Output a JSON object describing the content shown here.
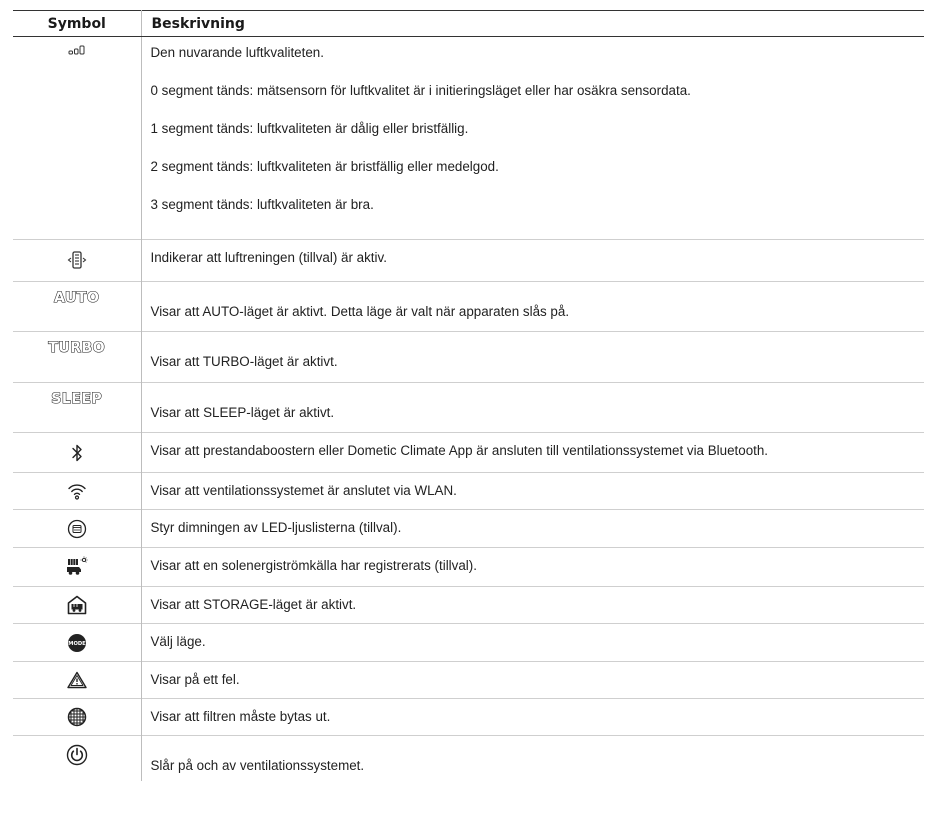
{
  "table": {
    "headers": {
      "symbol": "Symbol",
      "description": "Beskrivning"
    },
    "rows": {
      "air_quality": {
        "icon": "signal-bars-icon",
        "lines": [
          "Den nuvarande luftkvaliteten.",
          "0 segment tänds: mätsensorn för luftkvalitet är i initieringsläget eller har osäkra sensordata.",
          "1 segment tänds: luftkvaliteten är dålig eller bristfällig.",
          "2 segment tänds: luftkvaliteten är bristfällig eller medelgod.",
          "3 segment tänds: luftkvaliteten är bra."
        ]
      },
      "air_purification": {
        "icon": "air-purifier-icon",
        "text": "Indikerar att luftreningen (tillval) är aktiv."
      },
      "auto": {
        "icon_label": "AUTO",
        "text": "Visar att AUTO-läget är aktivt. Detta läge är valt när apparaten slås på."
      },
      "turbo": {
        "icon_label": "TURBO",
        "text": "Visar att TURBO-läget är aktivt."
      },
      "sleep": {
        "icon_label": "SLEEP",
        "text": "Visar att SLEEP-läget är aktivt."
      },
      "bluetooth": {
        "icon": "bluetooth-icon",
        "text": "Visar att prestandaboostern eller Dometic Climate App är ansluten till ventilationssystemet via Bluetooth."
      },
      "wlan": {
        "icon": "wifi-icon",
        "text": "Visar att ventilationssystemet är anslutet via WLAN."
      },
      "led": {
        "icon": "led-dimmer-icon",
        "text": "Styr dimningen av LED-ljuslisterna (tillval)."
      },
      "solar": {
        "icon": "solar-vehicle-icon",
        "text": "Visar att en solenergiströmkälla har registrerats (tillval)."
      },
      "storage": {
        "icon": "storage-garage-icon",
        "text": "Visar att STORAGE-läget är aktivt."
      },
      "mode": {
        "icon": "mode-button-icon",
        "icon_label": "MODE",
        "text": "Välj läge."
      },
      "error": {
        "icon": "warning-triangle-icon",
        "text": "Visar på ett fel."
      },
      "filter": {
        "icon": "filter-grid-icon",
        "text": "Visar att filtren måste bytas ut."
      },
      "power": {
        "icon": "power-icon",
        "text": "Slår på och av ventilationssystemet."
      }
    }
  }
}
